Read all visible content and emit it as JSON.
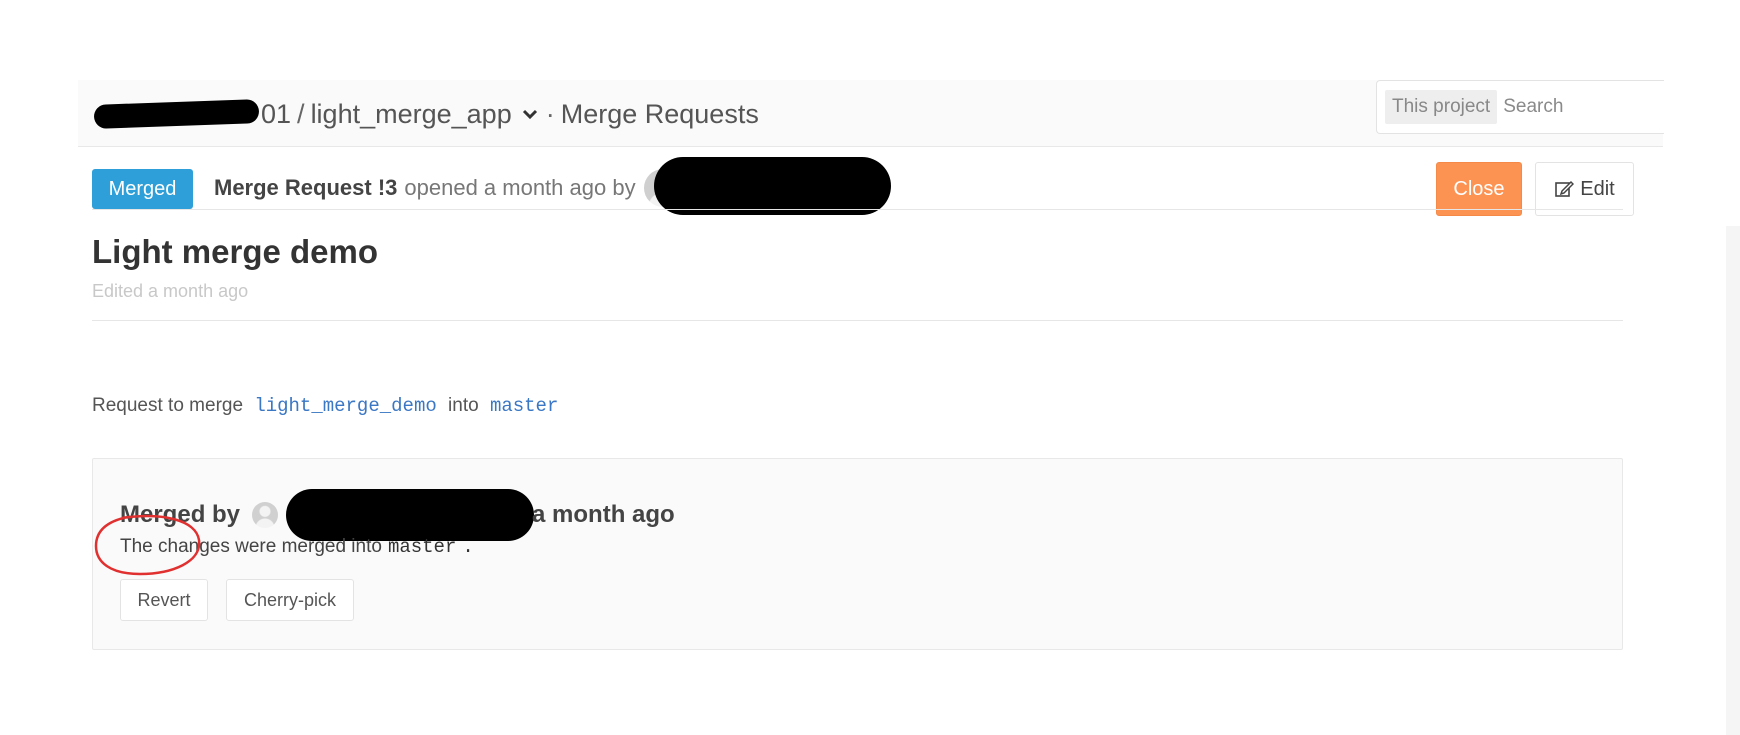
{
  "breadcrumb": {
    "group_suffix": "01",
    "separator": "/",
    "project": "light_merge_app",
    "dot": "·",
    "section": "Merge Requests"
  },
  "search": {
    "scope": "This project",
    "placeholder": "Search"
  },
  "merge_request": {
    "status_badge": "Merged",
    "label": "Merge Request !3",
    "opened_text": "opened a month ago by",
    "close_button": "Close",
    "edit_button": "Edit",
    "title": "Light merge demo",
    "edited": "Edited a month ago",
    "request_prefix": "Request to merge",
    "source_branch": "light_merge_demo",
    "into": "into",
    "target_branch": "master"
  },
  "merged_panel": {
    "merged_by": "Merged by",
    "when": "a month ago",
    "changes_text": "The changes were merged into",
    "changes_branch": "master",
    "changes_period": ".",
    "revert_button": "Revert",
    "cherry_pick_button": "Cherry-pick"
  },
  "colors": {
    "badge": "#2e9fd8",
    "close_button": "#fd9353",
    "branch_code": "#3a77c4",
    "annotation": "#e0302f"
  }
}
